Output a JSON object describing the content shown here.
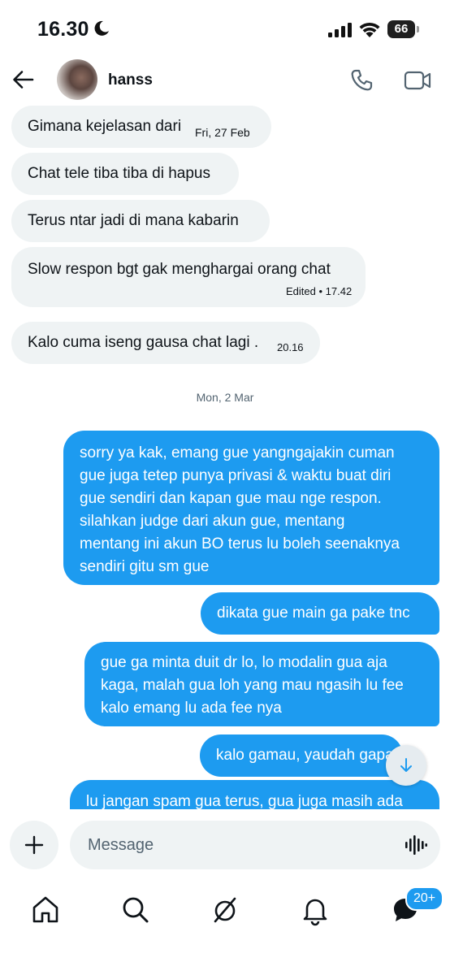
{
  "status_bar": {
    "time": "16.30",
    "battery": "66"
  },
  "header": {
    "contact_name": "hanss"
  },
  "conversation": {
    "incoming": [
      {
        "text": "Gimana kejelasan dari",
        "date_chip": "Fri, 27 Feb"
      },
      {
        "text": "Chat tele tiba tiba di hapus"
      },
      {
        "text": "Terus ntar jadi di mana kabarin"
      },
      {
        "text": "Slow respon bgt gak menghargai orang chat",
        "meta": "Edited • 17.42"
      },
      {
        "text": "Kalo cuma iseng gausa chat lagi .",
        "meta": "20.16"
      }
    ],
    "date_separator": "Mon, 2 Mar",
    "outgoing": [
      {
        "lines": [
          "sorry ya kak, emang gue yangngajakin cuman",
          "gue juga tetep punya privasi & waktu buat diri",
          "gue sendiri dan kapan gue mau nge respon.",
          "silahkan judge dari akun gue, mentang",
          "mentang ini akun BO terus lu boleh seenaknya",
          "sendiri gitu sm gue"
        ]
      },
      {
        "lines": [
          "dikata gue main ga pake tnc"
        ]
      },
      {
        "lines": [
          "gue ga minta duit dr lo, lo modalin gua aja",
          "kaga, malah gua loh yang mau ngasih lu fee",
          "kalo emang lu ada fee nya"
        ]
      },
      {
        "lines": [
          "kalo gamau, yaudah gapapa"
        ]
      },
      {
        "lines": [
          "lu jangan spam gua terus, gua juga masih ada"
        ]
      }
    ]
  },
  "composer": {
    "placeholder": "Message"
  },
  "tabbar": {
    "items": [
      "home-icon",
      "search-icon",
      "grok-icon",
      "notifications-icon",
      "messages-icon"
    ],
    "messages_badge": "20+"
  },
  "colors": {
    "accent": "#1d9bf0",
    "incoming_bubble": "#eff3f4"
  }
}
